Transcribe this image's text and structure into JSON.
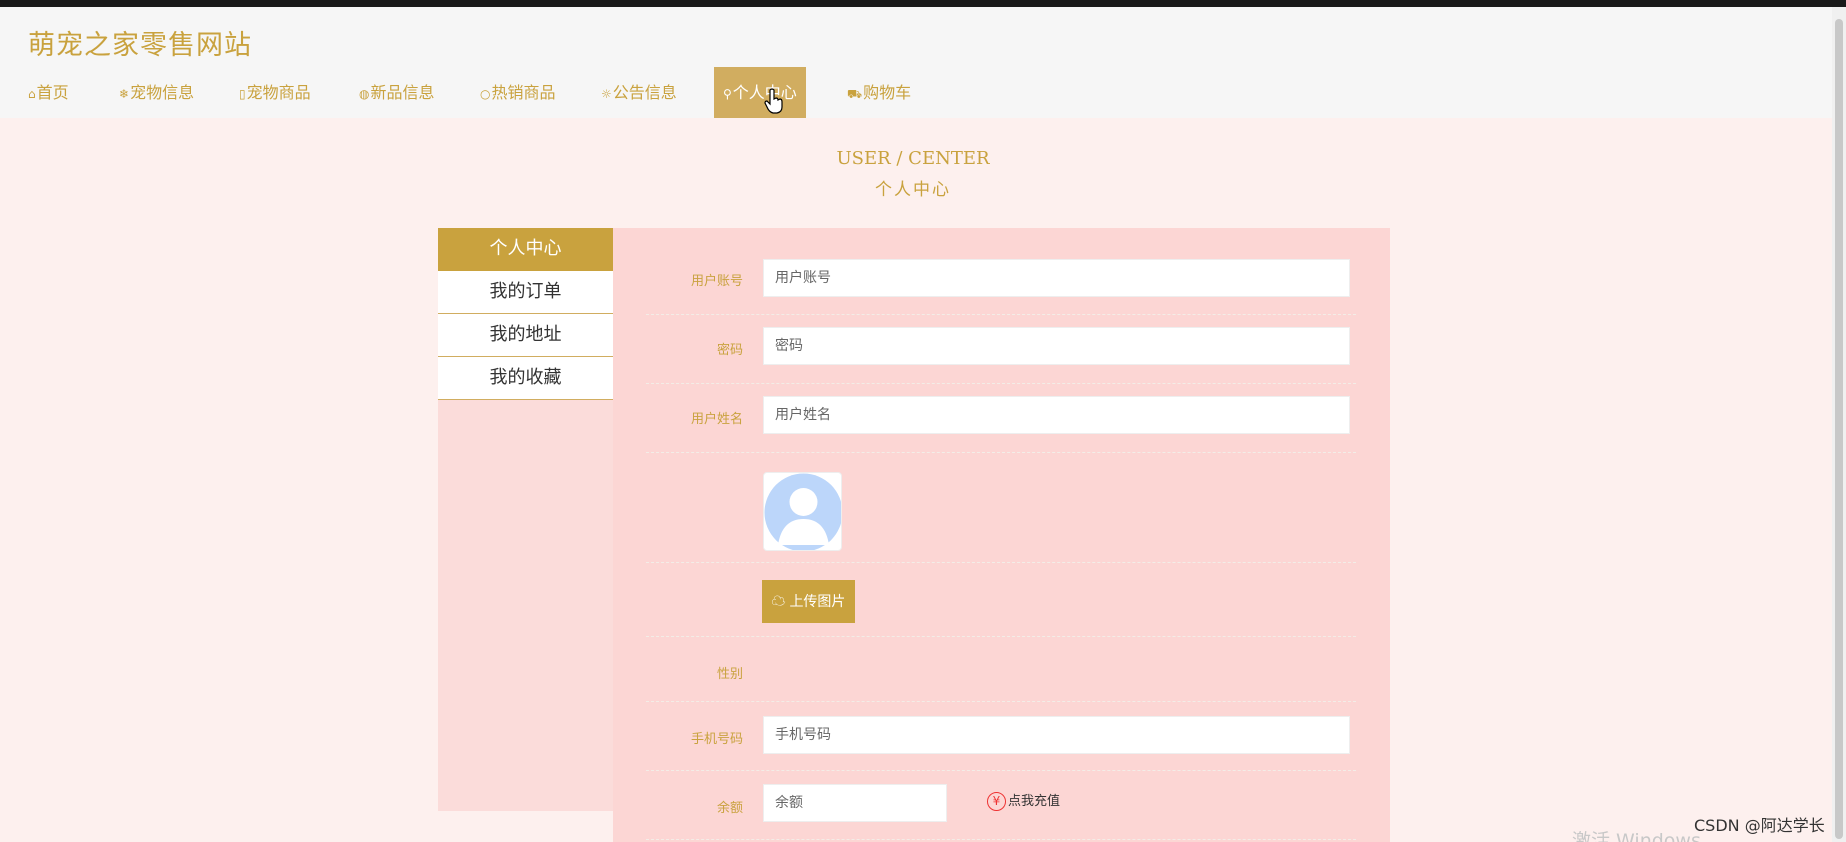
{
  "site": {
    "title": "萌宠之家零售网站"
  },
  "nav": [
    {
      "icon": "home-icon",
      "glyph": "⌂",
      "label": "首页",
      "active": false
    },
    {
      "icon": "pet-icon",
      "glyph": "❄",
      "label": "宠物信息",
      "active": false
    },
    {
      "icon": "goods-icon",
      "glyph": "▯",
      "label": "宠物商品",
      "active": false
    },
    {
      "icon": "new-icon",
      "glyph": "◍",
      "label": "新品信息",
      "active": false
    },
    {
      "icon": "hot-icon",
      "glyph": "○",
      "label": "热销商品",
      "active": false
    },
    {
      "icon": "notice-icon",
      "glyph": "☼",
      "label": "公告信息",
      "active": false
    },
    {
      "icon": "user-icon",
      "glyph": "⚲",
      "label": "个人中心",
      "active": true
    },
    {
      "icon": "cart-icon",
      "glyph": "⛟",
      "label": "购物车",
      "active": false
    }
  ],
  "page_head": {
    "en": "USER / CENTER",
    "cn": "个人中心"
  },
  "sidebar": [
    {
      "label": "个人中心",
      "active": true
    },
    {
      "label": "我的订单",
      "active": false
    },
    {
      "label": "我的地址",
      "active": false
    },
    {
      "label": "我的收藏",
      "active": false
    }
  ],
  "form": {
    "account": {
      "label": "用户账号",
      "placeholder": "用户账号"
    },
    "password": {
      "label": "密码",
      "placeholder": "密码"
    },
    "name": {
      "label": "用户姓名",
      "placeholder": "用户姓名"
    },
    "upload_label": "上传图片",
    "gender": {
      "label": "性别"
    },
    "phone": {
      "label": "手机号码",
      "placeholder": "手机号码"
    },
    "balance": {
      "label": "余额",
      "placeholder": "余额"
    },
    "recharge_label": "点我充值",
    "recharge_symbol": "¥"
  },
  "footer": {
    "watermark": "CSDN @阿达学长",
    "activate": "激活 Windows"
  },
  "colors": {
    "accent": "#c9a23e",
    "nav_active": "#d1ad60",
    "panel": "#fcd6d4",
    "page_bg": "#fdf0ee"
  }
}
